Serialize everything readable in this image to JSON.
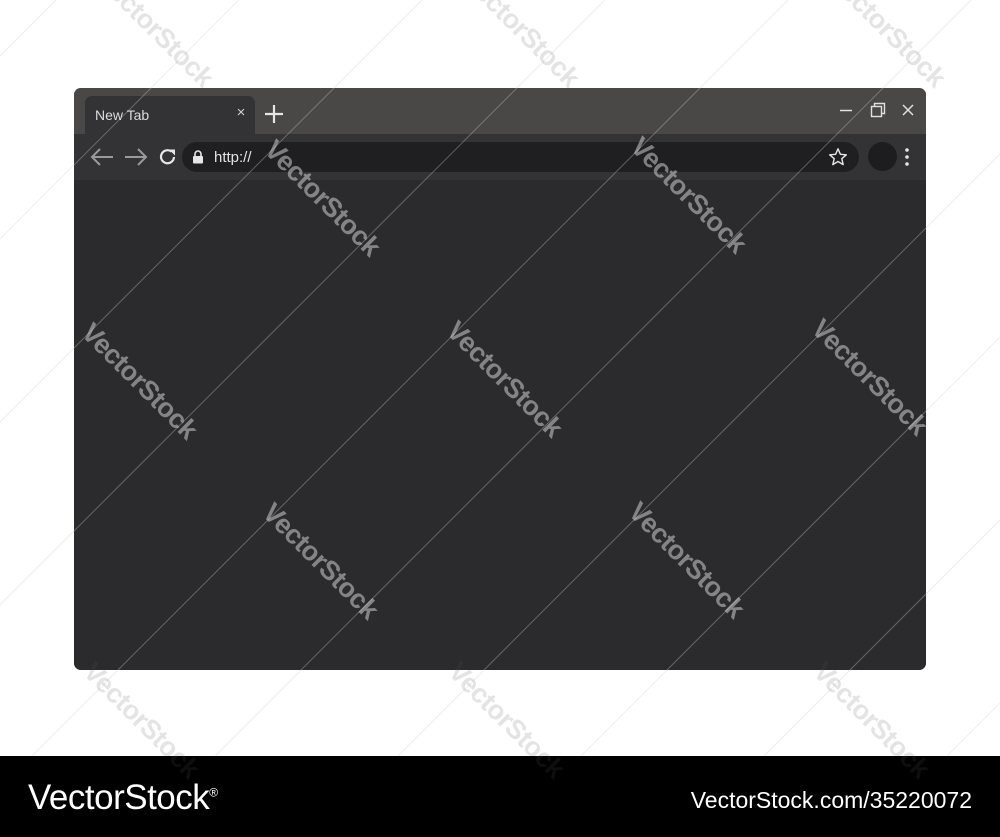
{
  "browser": {
    "tab": {
      "title": "New Tab",
      "close_glyph": "×",
      "close_icon": "close-icon"
    },
    "new_tab_icon": "plus-icon",
    "window_controls": [
      "minimize-icon",
      "restore-icon",
      "close-icon"
    ],
    "toolbar": {
      "back_icon": "arrow-left-icon",
      "forward_icon": "arrow-right-icon",
      "reload_icon": "reload-icon",
      "address": {
        "lock_icon": "lock-icon",
        "url": "http://",
        "bookmark_icon": "star-icon"
      },
      "profile_icon": "avatar",
      "menu_icon": "kebab-menu-icon"
    }
  },
  "watermark": {
    "text": "VectorStock"
  },
  "footer": {
    "brand": "VectorStock",
    "brand_mark": "®",
    "image_id": "VectorStock.com/35220072"
  },
  "colors": {
    "titlebar": "#4a4847",
    "toolbar": "#333234",
    "omnibox": "#1f1f21",
    "content": "#2b2b2d",
    "footer": "#000000"
  }
}
